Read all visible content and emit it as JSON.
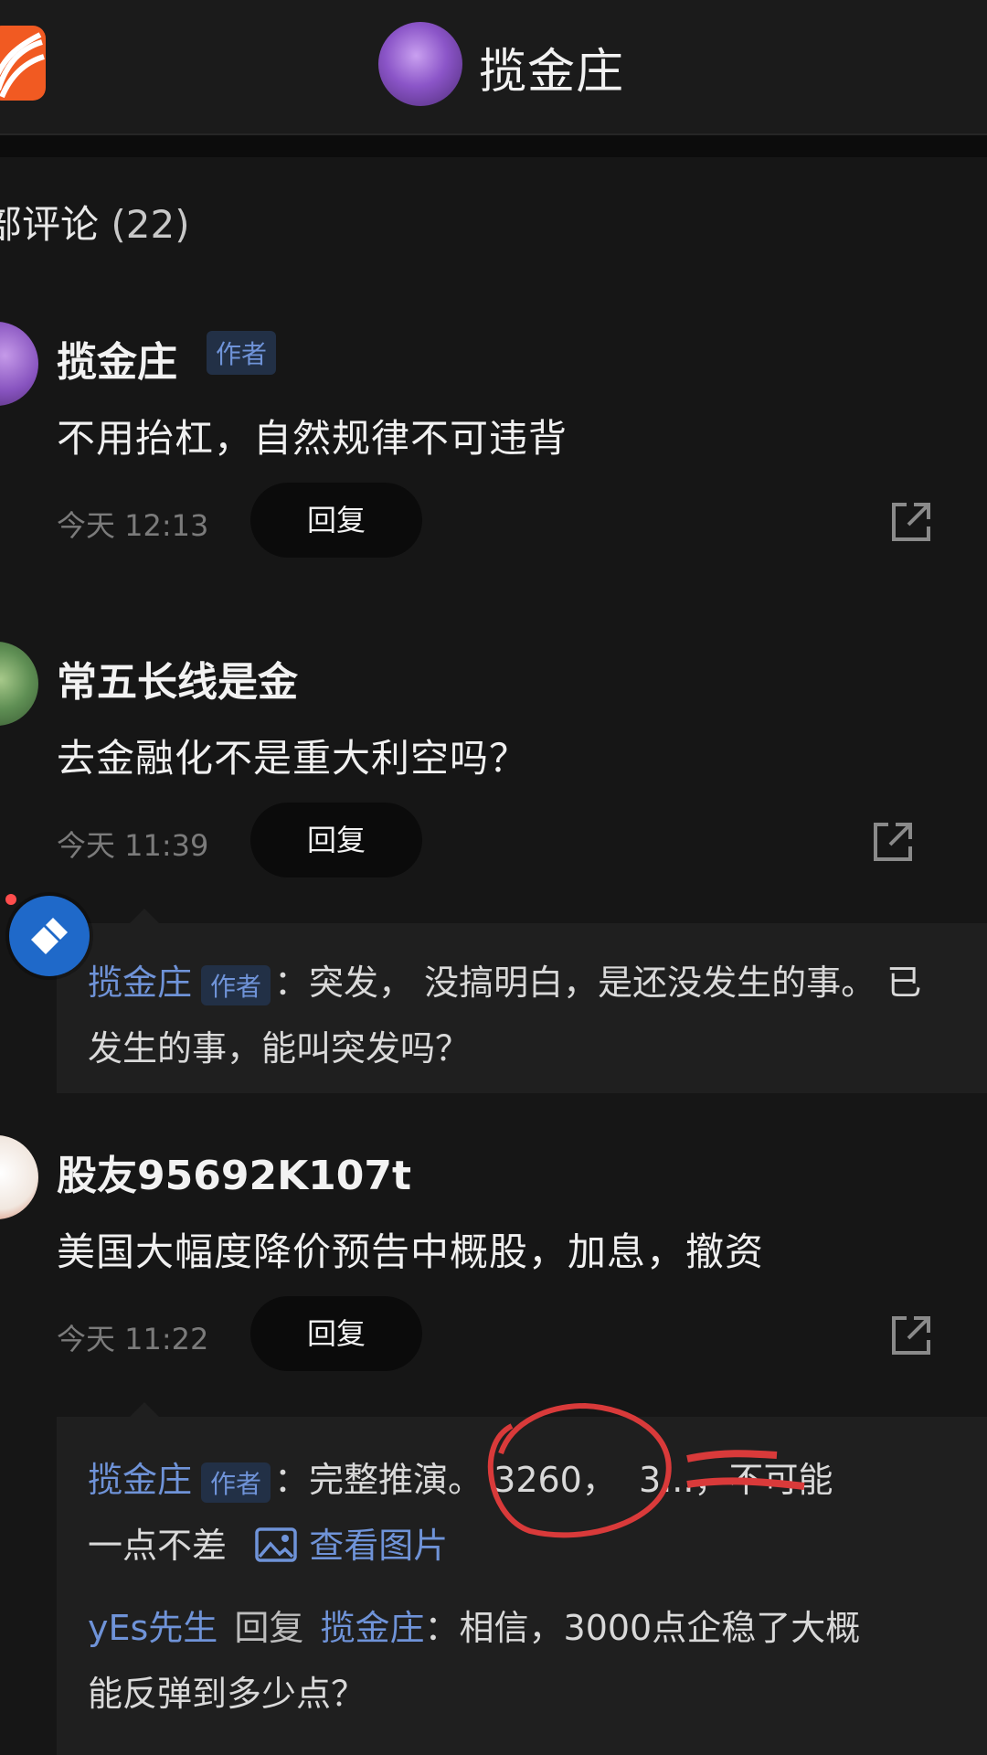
{
  "header": {
    "title": "揽金庄"
  },
  "section": {
    "title": "部评论",
    "count": "(22)"
  },
  "comments": [
    {
      "username": "揽金庄",
      "badge": "作者",
      "text": "不用抬杠，自然规律不可违背",
      "time": "今天 12:13",
      "reply_label": "回复"
    },
    {
      "username": "常五长线是金",
      "text": "去金融化不是重大利空吗？",
      "time": "今天 11:39",
      "reply_label": "回复",
      "replies": [
        {
          "name": "揽金庄",
          "badge": "作者",
          "line1": "：突发， 没搞明白，是还没发生的事。 已",
          "line2": "发生的事，能叫突发吗？"
        }
      ]
    },
    {
      "username": "股友95692K107t",
      "text": "美国大幅度降价预告中概股，加息，撤资",
      "time": "今天 11:22",
      "reply_label": "回复",
      "replies": [
        {
          "name": "揽金庄",
          "badge": "作者",
          "line1_prefix": "：完整推演。",
          "highlight_value": "3260，",
          "line1_suffix": "3...，不可能",
          "line2": "一点不差",
          "view_image_label": "查看图片"
        },
        {
          "name": "yEs先生",
          "reply_word": "回复",
          "target": "揽金庄",
          "line1": "：相信，3000点企稳了大概",
          "line2": "能反弹到多少点？"
        }
      ]
    }
  ]
}
